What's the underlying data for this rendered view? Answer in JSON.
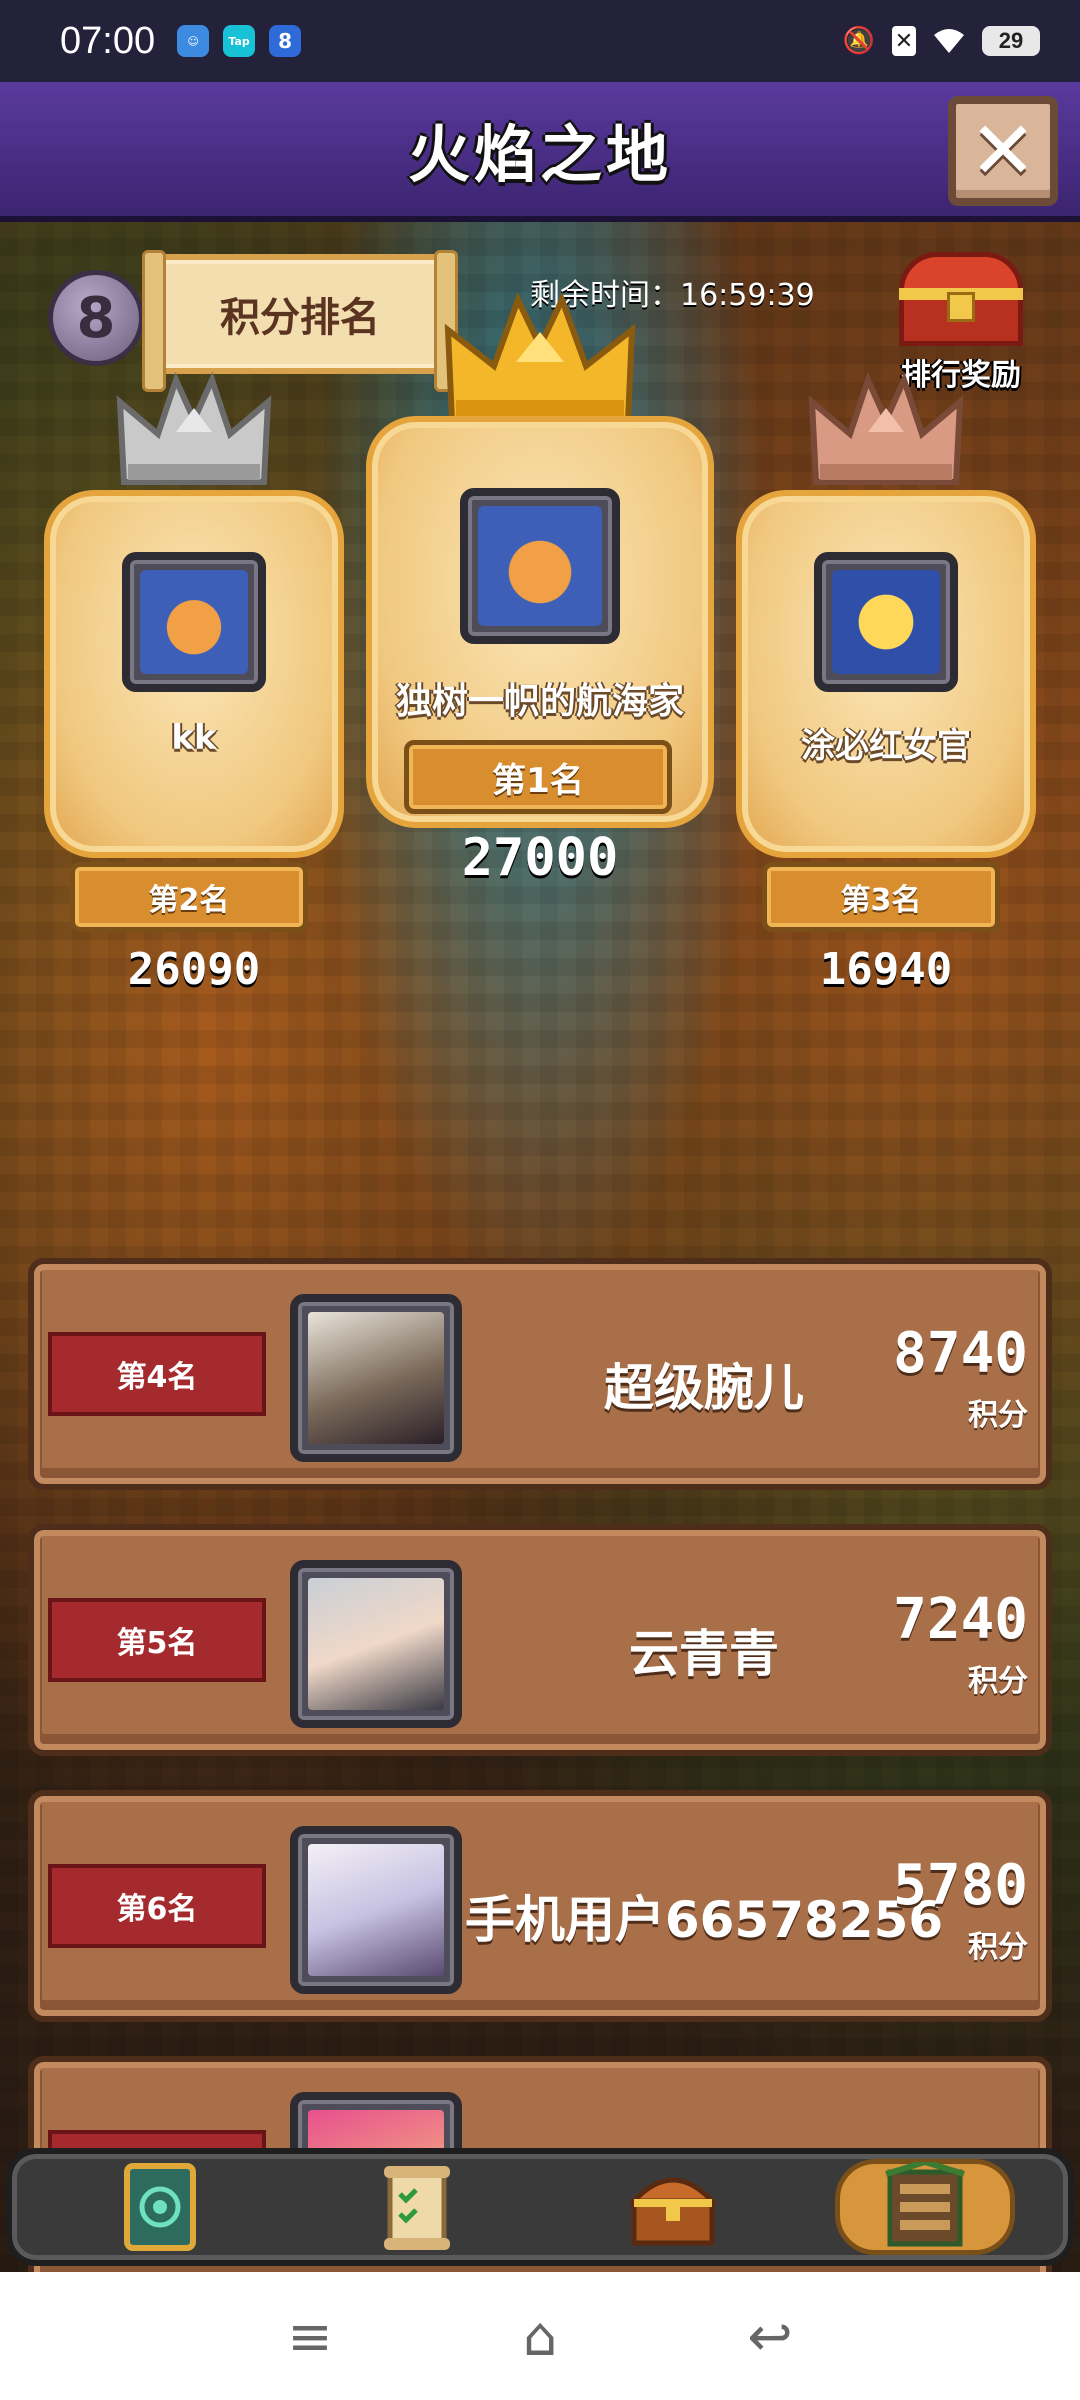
{
  "status_bar": {
    "time": "07:00",
    "apps": [
      "Tap",
      "8"
    ],
    "battery": "29"
  },
  "header": {
    "title": "火焰之地",
    "close_icon": "close-icon"
  },
  "top_info": {
    "season_number": "8",
    "ranking_label": "积分排名",
    "timer": "剩余时间：16:59:39",
    "reward_label": "排行奖励"
  },
  "podium": [
    {
      "rank_label": "第2名",
      "name": "kk",
      "score": "26090",
      "crown": "silver"
    },
    {
      "rank_label": "第1名",
      "name": "独树一帜的航海家",
      "score": "27000",
      "crown": "gold"
    },
    {
      "rank_label": "第3名",
      "name": "涂必红女官",
      "score": "16940",
      "crown": "bronze"
    }
  ],
  "list": [
    {
      "rank_label": "第4名",
      "name": "超级腕儿",
      "score": "8740",
      "unit": "积分"
    },
    {
      "rank_label": "第5名",
      "name": "云青青",
      "score": "7240",
      "unit": "积分"
    },
    {
      "rank_label": "第6名",
      "name": "手机用户66578256",
      "score": "5780",
      "unit": "积分"
    }
  ],
  "bottom_nav": [
    "card-icon",
    "quest-scroll-icon",
    "treasure-chest-icon",
    "ranking-board-icon"
  ],
  "colors": {
    "title_bar": "#4a2f88",
    "rank_red": "#a52a2e",
    "row_brown": "#a86f48",
    "gold_card": "#f0c77e"
  }
}
